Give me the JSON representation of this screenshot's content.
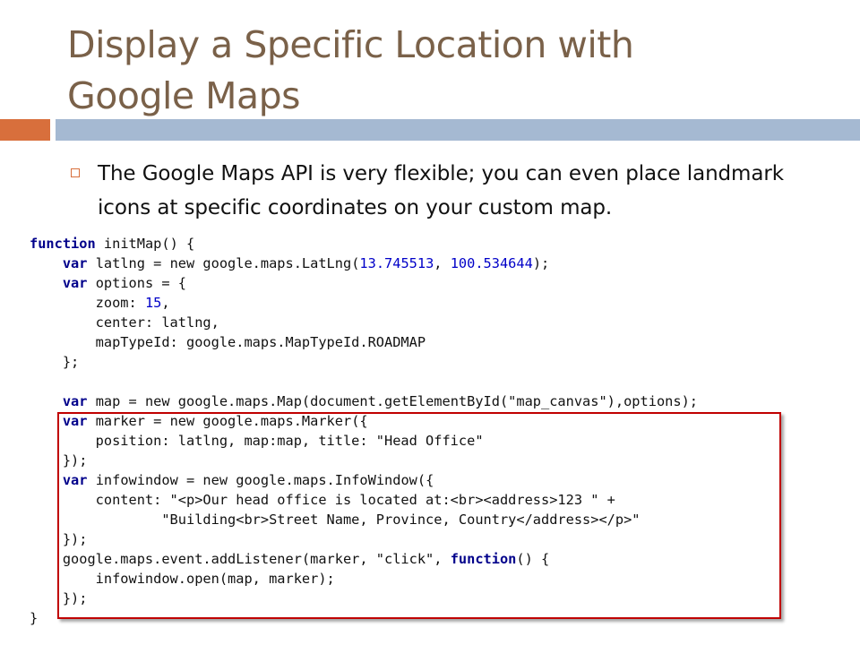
{
  "slide": {
    "title_line1": "Display a Specific Location with",
    "title_line2": "Google Maps",
    "bullet": "The Google Maps API is very flexible; you can even place landmark icons at specific coordinates on your custom map."
  },
  "colors": {
    "title": "#7a6149",
    "accent_orange": "#d86f3c",
    "accent_blue": "#a5b9d2",
    "keyword": "#00008b",
    "highlight_border": "#c00000"
  },
  "code": {
    "l1": {
      "kw": "function",
      "rest": " initMap() {"
    },
    "l2": {
      "indent": "    ",
      "kw": "var",
      "a": " latlng = new google.maps.LatLng(",
      "n1": "13.745513",
      "sep": ", ",
      "n2": "100.534644",
      "b": ");"
    },
    "l3": {
      "indent": "    ",
      "kw": "var",
      "rest": " options = {"
    },
    "l4": {
      "text": "        zoom: ",
      "num": "15",
      "end": ","
    },
    "l5": {
      "text": "        center: latlng,"
    },
    "l6": {
      "text": "        mapTypeId: google.maps.MapTypeId.ROADMAP"
    },
    "l7": {
      "text": "    };"
    },
    "l8": {
      "text": ""
    },
    "l9": {
      "indent": "    ",
      "kw": "var",
      "rest": " map = new google.maps.Map(document.getElementById(\"map_canvas\"),options);"
    },
    "l10": {
      "indent": "    ",
      "kw": "var",
      "rest": " marker = new google.maps.Marker({"
    },
    "l11": {
      "text": "        position: latlng, map:map, title: \"Head Office\""
    },
    "l12": {
      "text": "    });"
    },
    "l13": {
      "indent": "    ",
      "kw": "var",
      "rest": " infowindow = new google.maps.InfoWindow({"
    },
    "l14": {
      "text": "        content: \"<p>Our head office is located at:<br><address>123 \" +"
    },
    "l15": {
      "text": "                \"Building<br>Street Name, Province, Country</address></p>\""
    },
    "l16": {
      "text": "    });"
    },
    "l17": {
      "a": "    google.maps.event.addListener(marker, \"click\", ",
      "kw": "function",
      "b": "() {"
    },
    "l18": {
      "text": "        infowindow.open(map, marker);"
    },
    "l19": {
      "text": "    });"
    },
    "l20": {
      "text": "}"
    }
  }
}
